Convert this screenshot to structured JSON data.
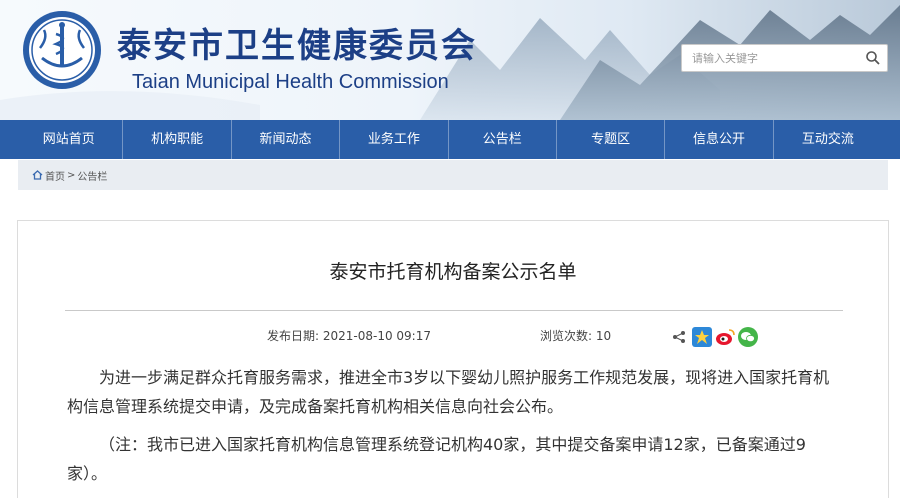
{
  "header": {
    "title_cn": "泰安市卫生健康委员会",
    "title_en": "Taian  Municipal  Health  Commission",
    "search_placeholder": "请输入关键字",
    "logo": "health-emblem",
    "search_icon": "search-icon"
  },
  "nav": {
    "items": [
      {
        "label": "网站首页"
      },
      {
        "label": "机构职能"
      },
      {
        "label": "新闻动态"
      },
      {
        "label": "业务工作"
      },
      {
        "label": "公告栏"
      },
      {
        "label": "专题区"
      },
      {
        "label": "信息公开"
      },
      {
        "label": "互动交流"
      }
    ]
  },
  "breadcrumb": {
    "home": "首页",
    "separator": ">",
    "current": "公告栏"
  },
  "article": {
    "title": "泰安市托育机构备案公示名单",
    "date_label": "发布日期: 2021-08-10 09:17",
    "views_label": "浏览次数: 10",
    "paragraph1": "为进一步满足群众托育服务需求，推进全市3岁以下婴幼儿照护服务工作规范发展，现将进入国家托育机构信息管理系统提交申请，及完成备案托育机构相关信息向社会公布。",
    "paragraph2": "（注：我市已进入国家托育机构信息管理系统登记机构40家，其中提交备案申请12家，已备案通过9家）。",
    "share_icons": [
      "share-icon",
      "qzone-icon",
      "weibo-icon",
      "wechat-icon"
    ]
  },
  "colors": {
    "nav_bg": "#2a5ea8",
    "title_blue": "#1c3f86",
    "crumb_bg": "#e9edf2"
  }
}
